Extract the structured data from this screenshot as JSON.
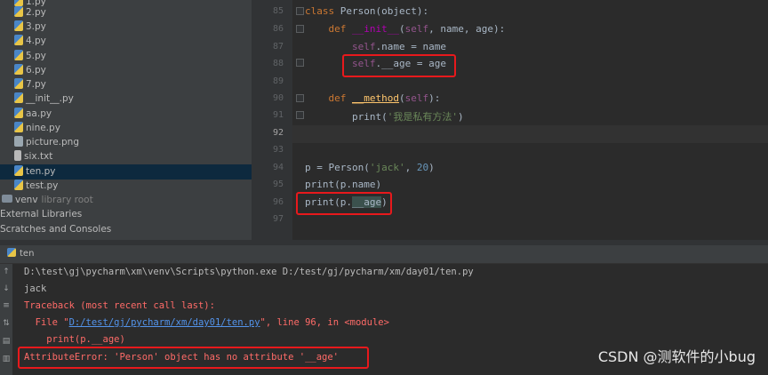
{
  "project_tree": {
    "items": [
      {
        "label": "1.py",
        "icon": "python-file-icon"
      },
      {
        "label": "2.py",
        "icon": "python-file-icon"
      },
      {
        "label": "3.py",
        "icon": "python-file-icon"
      },
      {
        "label": "4.py",
        "icon": "python-file-icon"
      },
      {
        "label": "5.py",
        "icon": "python-file-icon"
      },
      {
        "label": "6.py",
        "icon": "python-file-icon"
      },
      {
        "label": "7.py",
        "icon": "python-file-icon"
      },
      {
        "label": "__init__.py",
        "icon": "python-file-icon"
      },
      {
        "label": "aa.py",
        "icon": "python-file-icon"
      },
      {
        "label": "nine.py",
        "icon": "python-file-icon"
      },
      {
        "label": "picture.png",
        "icon": "image-file-icon"
      },
      {
        "label": "six.txt",
        "icon": "text-file-icon"
      },
      {
        "label": "ten.py",
        "icon": "python-file-icon",
        "selected": true
      },
      {
        "label": "test.py",
        "icon": "python-file-icon"
      }
    ],
    "venv_label": "venv",
    "venv_hint": "library root",
    "external_libraries": "External Libraries",
    "scratches": "Scratches and Consoles"
  },
  "editor": {
    "line_numbers": [
      "85",
      "86",
      "87",
      "88",
      "89",
      "90",
      "91",
      "92",
      "93",
      "94",
      "95",
      "96",
      "97"
    ],
    "current_line": "92"
  },
  "run_panel": {
    "tab_label": "ten",
    "lines": [
      "D:\\test\\gj\\pycharm\\xm\\venv\\Scripts\\python.exe D:/test/gj/pycharm/xm/day01/ten.py",
      "jack",
      "Traceback (most recent call last):",
      "  File \"",
      "D:/test/gj/pycharm/xm/day01/ten.py",
      "\", line 96, in <module>",
      "    print(p.__age)",
      "AttributeError: 'Person' object has no attribute '__age'"
    ]
  },
  "watermark": "CSDN @测软件的小bug",
  "colors": {
    "highlight_box": "#e8191c",
    "error_text": "#ff6b68",
    "link": "#5394ec",
    "selected_row": "#0d293e"
  }
}
